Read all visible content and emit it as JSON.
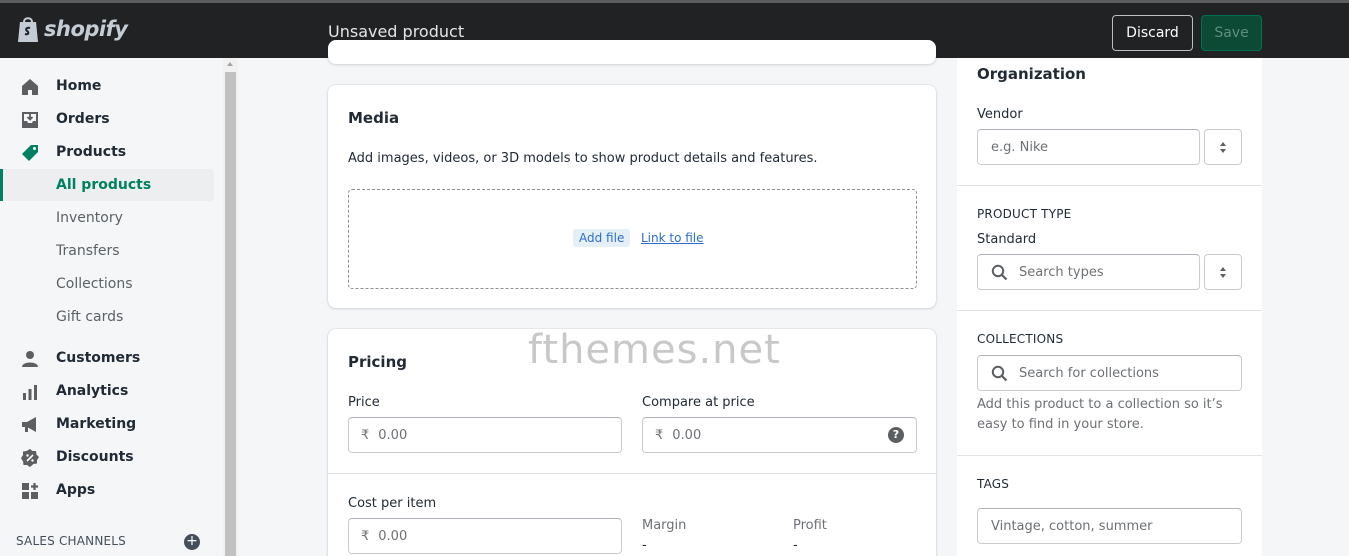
{
  "brand": {
    "name": "shopify"
  },
  "topbar": {
    "title": "Unsaved product",
    "discard_label": "Discard",
    "save_label": "Save"
  },
  "sidebar": {
    "items": [
      {
        "label": "Home",
        "icon": "home-icon"
      },
      {
        "label": "Orders",
        "icon": "orders-icon"
      },
      {
        "label": "Products",
        "icon": "tag-icon"
      },
      {
        "label": "All products",
        "active": true
      },
      {
        "label": "Inventory"
      },
      {
        "label": "Transfers"
      },
      {
        "label": "Collections"
      },
      {
        "label": "Gift cards"
      },
      {
        "label": "Customers",
        "icon": "person-icon"
      },
      {
        "label": "Analytics",
        "icon": "bar-chart-icon"
      },
      {
        "label": "Marketing",
        "icon": "megaphone-icon"
      },
      {
        "label": "Discounts",
        "icon": "discount-icon"
      },
      {
        "label": "Apps",
        "icon": "apps-icon"
      }
    ],
    "sales_channels_label": "SALES CHANNELS"
  },
  "media": {
    "title": "Media",
    "description": "Add images, videos, or 3D models to show product details and features.",
    "add_file": "Add file",
    "link_to_file": "Link to file"
  },
  "pricing": {
    "title": "Pricing",
    "price_label": "Price",
    "price_currency": "₹",
    "price_placeholder": "0.00",
    "compare_label": "Compare at price",
    "compare_currency": "₹",
    "compare_placeholder": "0.00",
    "cost_label": "Cost per item",
    "cost_currency": "₹",
    "cost_placeholder": "0.00",
    "margin_label": "Margin",
    "margin_value": "-",
    "profit_label": "Profit",
    "profit_value": "-"
  },
  "organization": {
    "title": "Organization",
    "vendor_label": "Vendor",
    "vendor_placeholder": "e.g. Nike",
    "product_type_heading": "PRODUCT TYPE",
    "product_type_value": "Standard",
    "product_type_placeholder": "Search types",
    "collections_heading": "COLLECTIONS",
    "collections_placeholder": "Search for collections",
    "collections_help": "Add this product to a collection so it’s easy to find in your store.",
    "tags_heading": "TAGS",
    "tags_placeholder": "Vintage, cotton, summer"
  },
  "watermark": "fthemes.net",
  "colors": {
    "accent": "#008060",
    "topbar": "#202223",
    "save_bg": "#0d4a36",
    "link": "#2c6ecb"
  }
}
